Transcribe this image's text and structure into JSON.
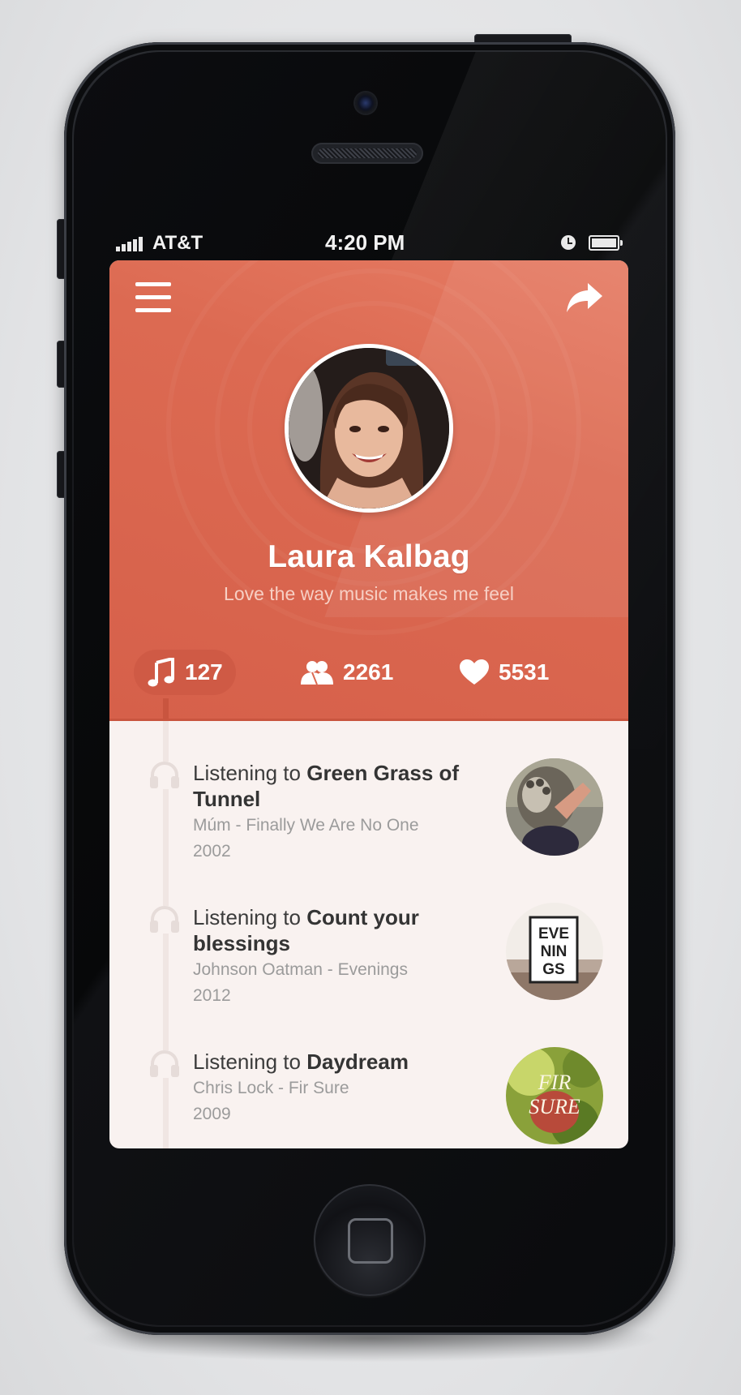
{
  "status_bar": {
    "carrier": "AT&T",
    "time": "4:20 PM"
  },
  "profile": {
    "name": "Laura Kalbag",
    "bio": "Love the way music makes me feel"
  },
  "stats": {
    "songs": "127",
    "friends": "2261",
    "likes": "5531"
  },
  "feed": [
    {
      "prefix": "Listening to",
      "track": "Green Grass of Tunnel",
      "artist_album": "Múm - Finally We Are No One",
      "year": "2002",
      "cover_text": ""
    },
    {
      "prefix": "Listening to",
      "track": "Count your blessings",
      "artist_album": "Johnson Oatman  - Evenings",
      "year": "2012",
      "cover_text": "EVENINGS"
    },
    {
      "prefix": "Listening to",
      "track": "Daydream",
      "artist_album": "Chris Lock - Fir Sure",
      "year": "2009",
      "cover_text": "FIR SURE"
    }
  ],
  "colors": {
    "accent": "#dc6a52",
    "accent_dark": "#cf5a45",
    "feed_background": "#f9f2f0"
  }
}
